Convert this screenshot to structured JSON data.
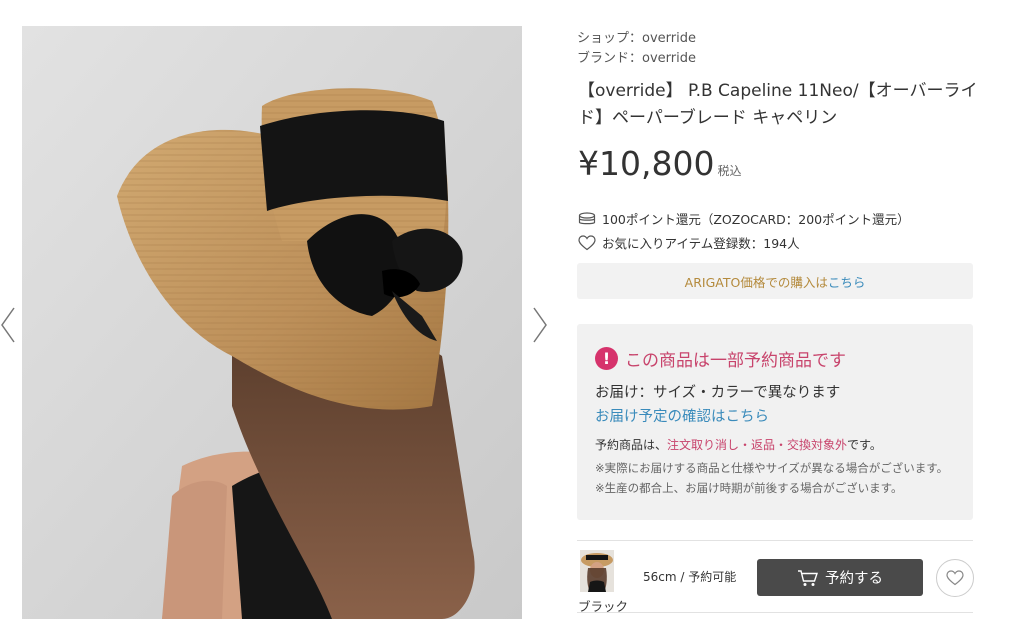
{
  "shop": {
    "label": "ショップ：",
    "value": "override"
  },
  "brand": {
    "label": "ブランド：",
    "value": "override"
  },
  "product": {
    "title": "【override】 P.B Capeline 11Neo/【オーバーライド】ペーパーブレード キャペリン",
    "price": "¥10,800",
    "tax": "税込"
  },
  "points": "100ポイント還元（ZOZOCARD：200ポイント還元）",
  "favorites": "お気に入りアイテム登録数：194人",
  "arigato": {
    "text": "ARIGATO価格での購入は",
    "link": "こちら"
  },
  "notice": {
    "heading": "この商品は一部予約商品です",
    "delivery": "お届け：サイズ・カラーで異なります",
    "delivery_link": "お届け予定の確認はこちら",
    "policy_prefix": "予約商品は、",
    "policy_highlight": "注文取り消し・返品・交換対象外",
    "policy_suffix": "です。",
    "note1": "※実際にお届けする商品と仕様やサイズが異なる場合がございます。",
    "note2": "※生産の都合上、お届け時期が前後する場合がございます。"
  },
  "variant": {
    "color": "ブラック",
    "stock": "56cm / 予約可能",
    "button": "予約する"
  },
  "icons": {
    "prev": "chevron-left-icon",
    "next": "chevron-right-icon",
    "points": "coin-stack-icon",
    "favorite": "heart-outline-icon",
    "alert": "exclamation-icon",
    "cart": "cart-icon"
  },
  "colors": {
    "accent_pink": "#c8446c",
    "link_blue": "#3a8bbb",
    "button_dark": "#4a4a4a",
    "arigato_gold": "#b48a3c"
  }
}
